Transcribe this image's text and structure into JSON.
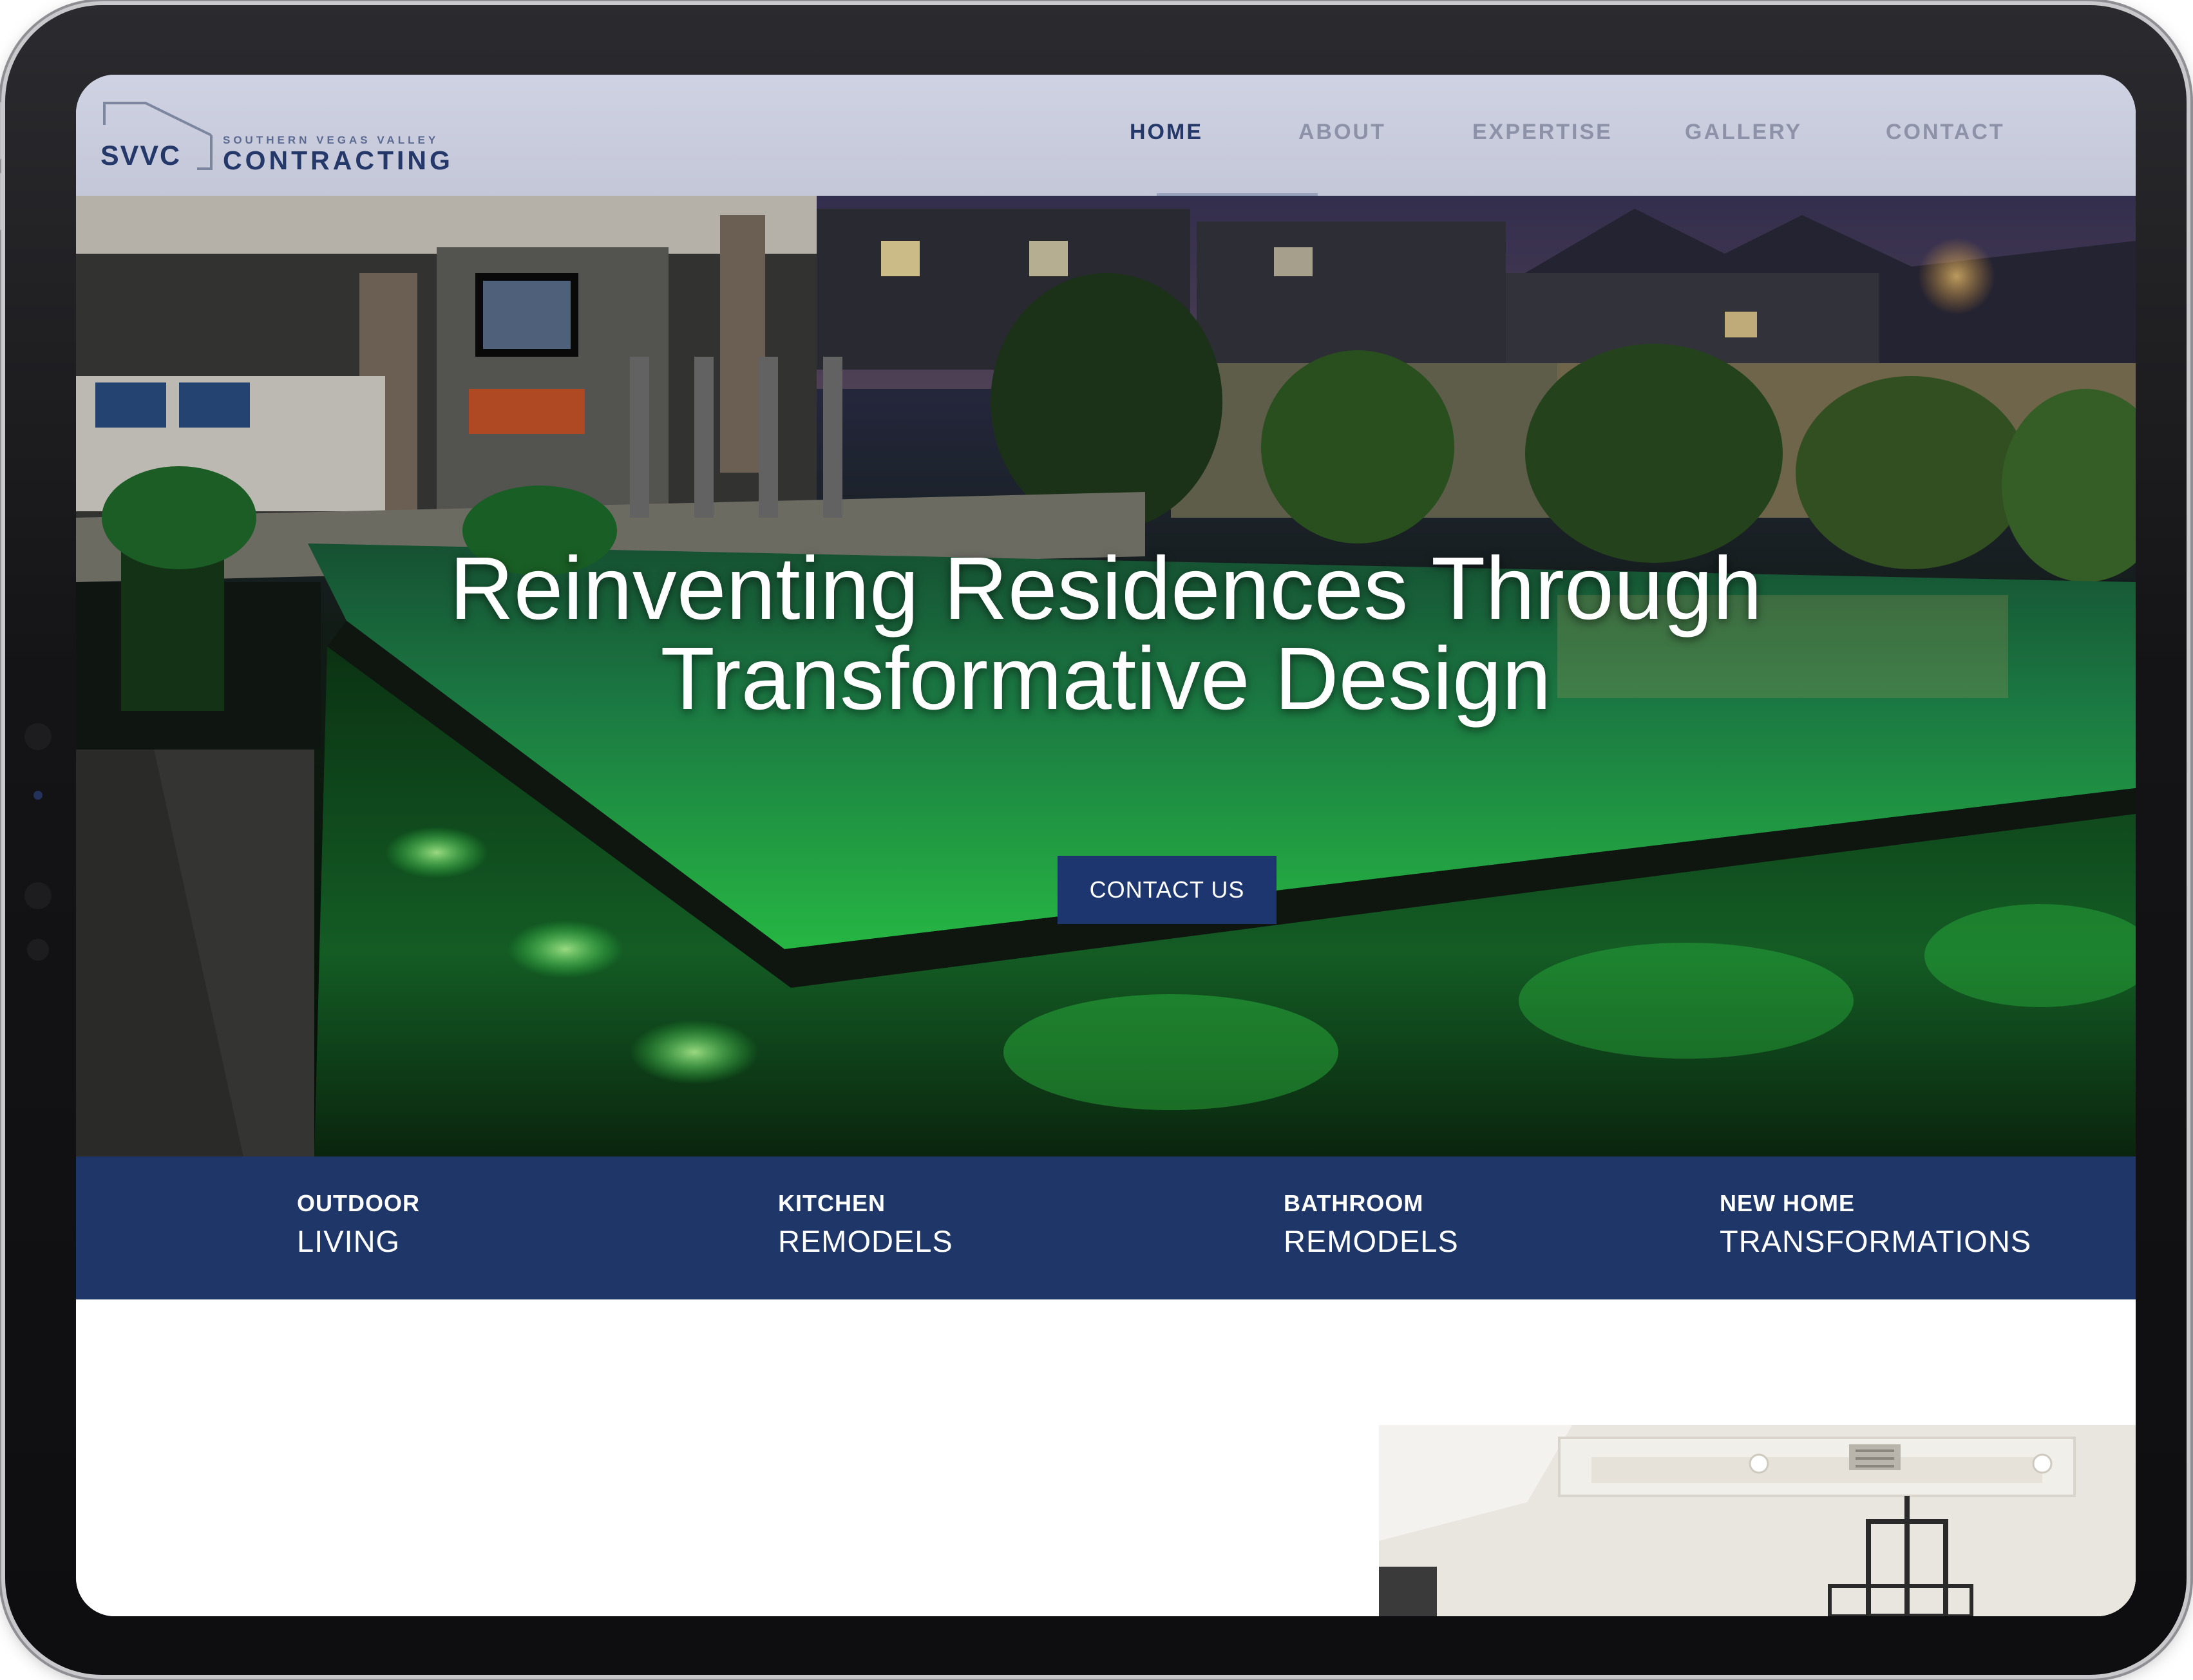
{
  "brand": {
    "abbr": "SVVC",
    "tagline": "SOUTHERN VEGAS VALLEY",
    "name": "CONTRACTING"
  },
  "nav": {
    "items": [
      {
        "label": "HOME",
        "active": true
      },
      {
        "label": "ABOUT",
        "active": false
      },
      {
        "label": "EXPERTISE",
        "active": false
      },
      {
        "label": "GALLERY",
        "active": false
      },
      {
        "label": "CONTACT",
        "active": false
      }
    ]
  },
  "hero": {
    "title_line1": "Reinventing Residences Through",
    "title_line2": "Transformative Design",
    "cta_label": "CONTACT US"
  },
  "services": [
    {
      "top": "OUTDOOR",
      "bottom": "LIVING"
    },
    {
      "top": "KITCHEN",
      "bottom": "REMODELS"
    },
    {
      "top": "BATHROOM",
      "bottom": "REMODELS"
    },
    {
      "top": "NEW HOME",
      "bottom": "TRANSFORMATIONS"
    }
  ],
  "colors": {
    "brand_navy": "#1f3669",
    "nav_inactive": "#8d92a8",
    "pool_green": "#2fd94a"
  }
}
